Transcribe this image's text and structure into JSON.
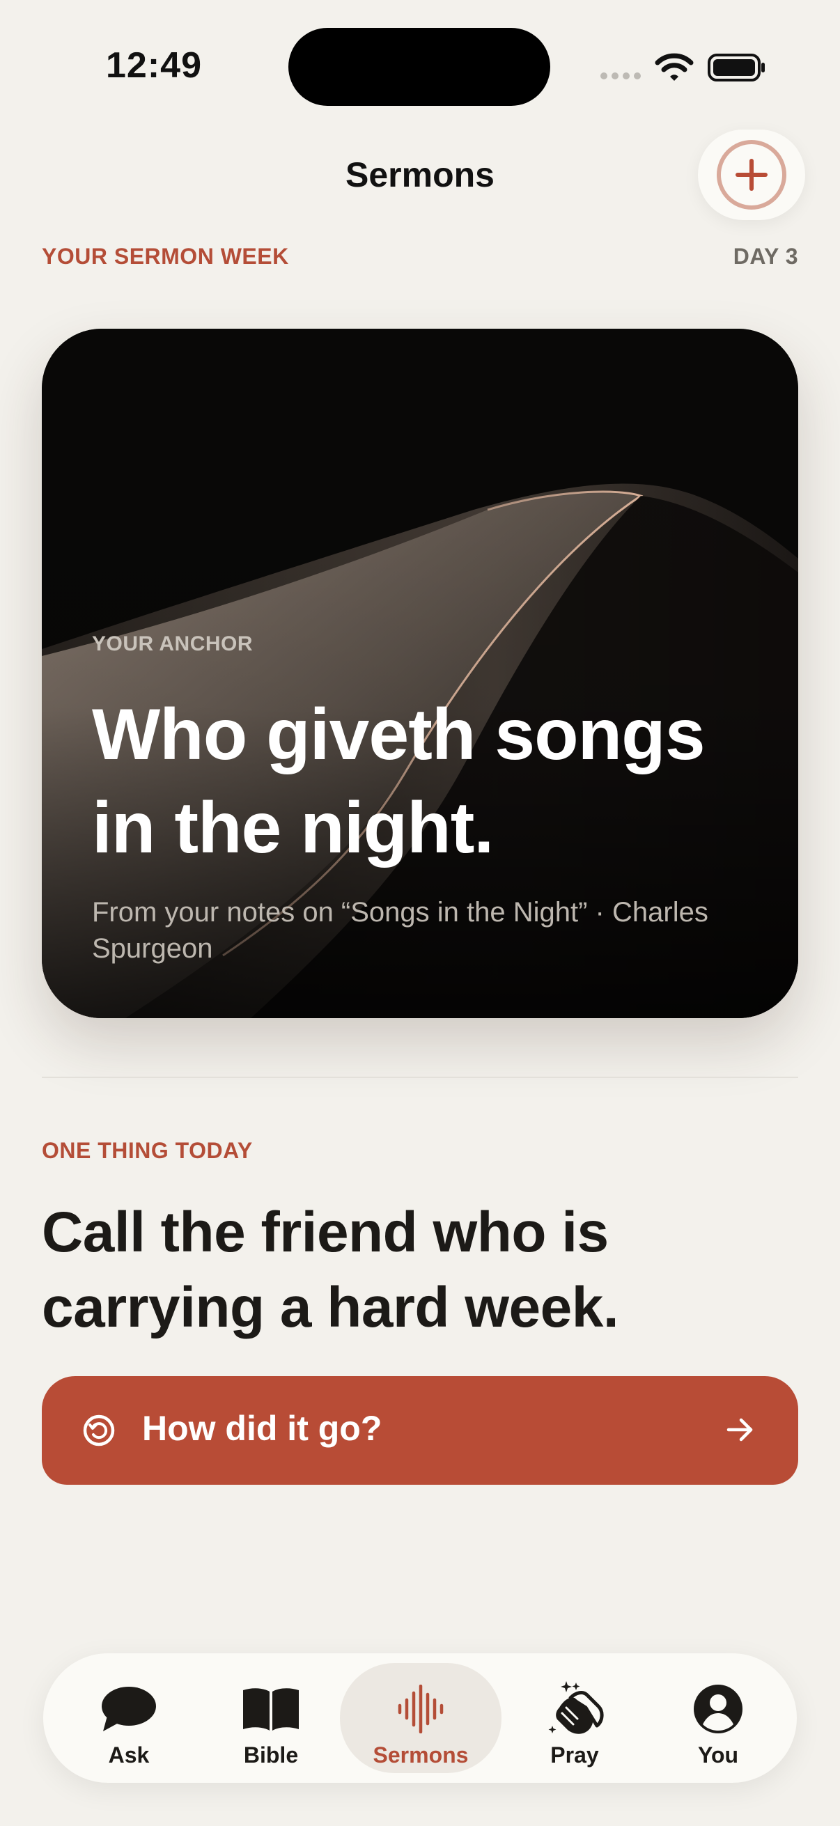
{
  "status_bar": {
    "time": "12:49"
  },
  "header": {
    "title": "Sermons",
    "add_icon": "plus-circle-icon"
  },
  "week": {
    "label": "YOUR SERMON WEEK",
    "day": "DAY 3"
  },
  "anchor": {
    "eyebrow": "YOUR ANCHOR",
    "quote": "Who giveth songs in the night.",
    "source": "From your notes on “Songs in the Night” · Charles Spurgeon"
  },
  "today": {
    "label": "ONE THING TODAY",
    "task": "Call the friend who is carrying a hard week."
  },
  "checkin": {
    "label": "How did it go?",
    "icon": "history-icon",
    "arrow": "arrow-right-icon"
  },
  "tabs": [
    {
      "label": "Ask",
      "icon": "chat-bubble-icon"
    },
    {
      "label": "Bible",
      "icon": "open-book-icon"
    },
    {
      "label": "Sermons",
      "icon": "waveform-icon"
    },
    {
      "label": "Pray",
      "icon": "clapping-hands-icon"
    },
    {
      "label": "You",
      "icon": "person-circle-icon"
    }
  ],
  "colors": {
    "accent": "#B84C36",
    "background": "#F3F1EC",
    "card": "#080706"
  }
}
